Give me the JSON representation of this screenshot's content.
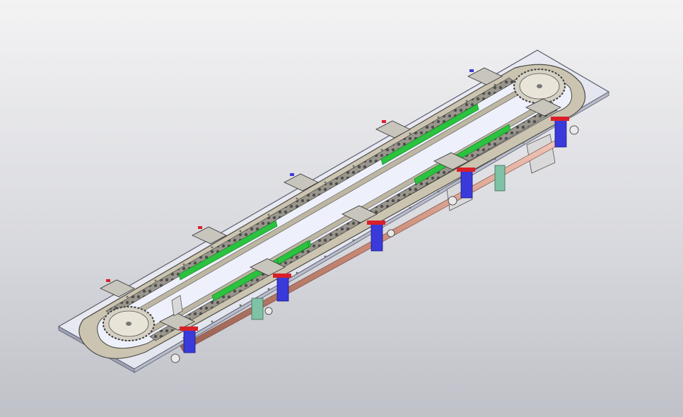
{
  "scene": {
    "background_top": "#f3f3f4",
    "background_bottom": "#bfc1c8",
    "base_plate_color": "#e6e8f2",
    "rail_color": "#c9c1ad",
    "chain_color": "#6f6f6f",
    "sprocket_color": "#d6d1c4",
    "guide_strip_color": "#2bc23f",
    "carrier_plate_color": "#c8c5bd",
    "clamp_color": "#3a3adb",
    "clamp_accent_color": "#d8202a",
    "shaft_color": "#d4a090",
    "bracket_color": "#7fc2a6",
    "icons": [
      "sprocket-icon",
      "chain-link-icon",
      "carrier-plate-icon",
      "clamp-icon"
    ]
  }
}
